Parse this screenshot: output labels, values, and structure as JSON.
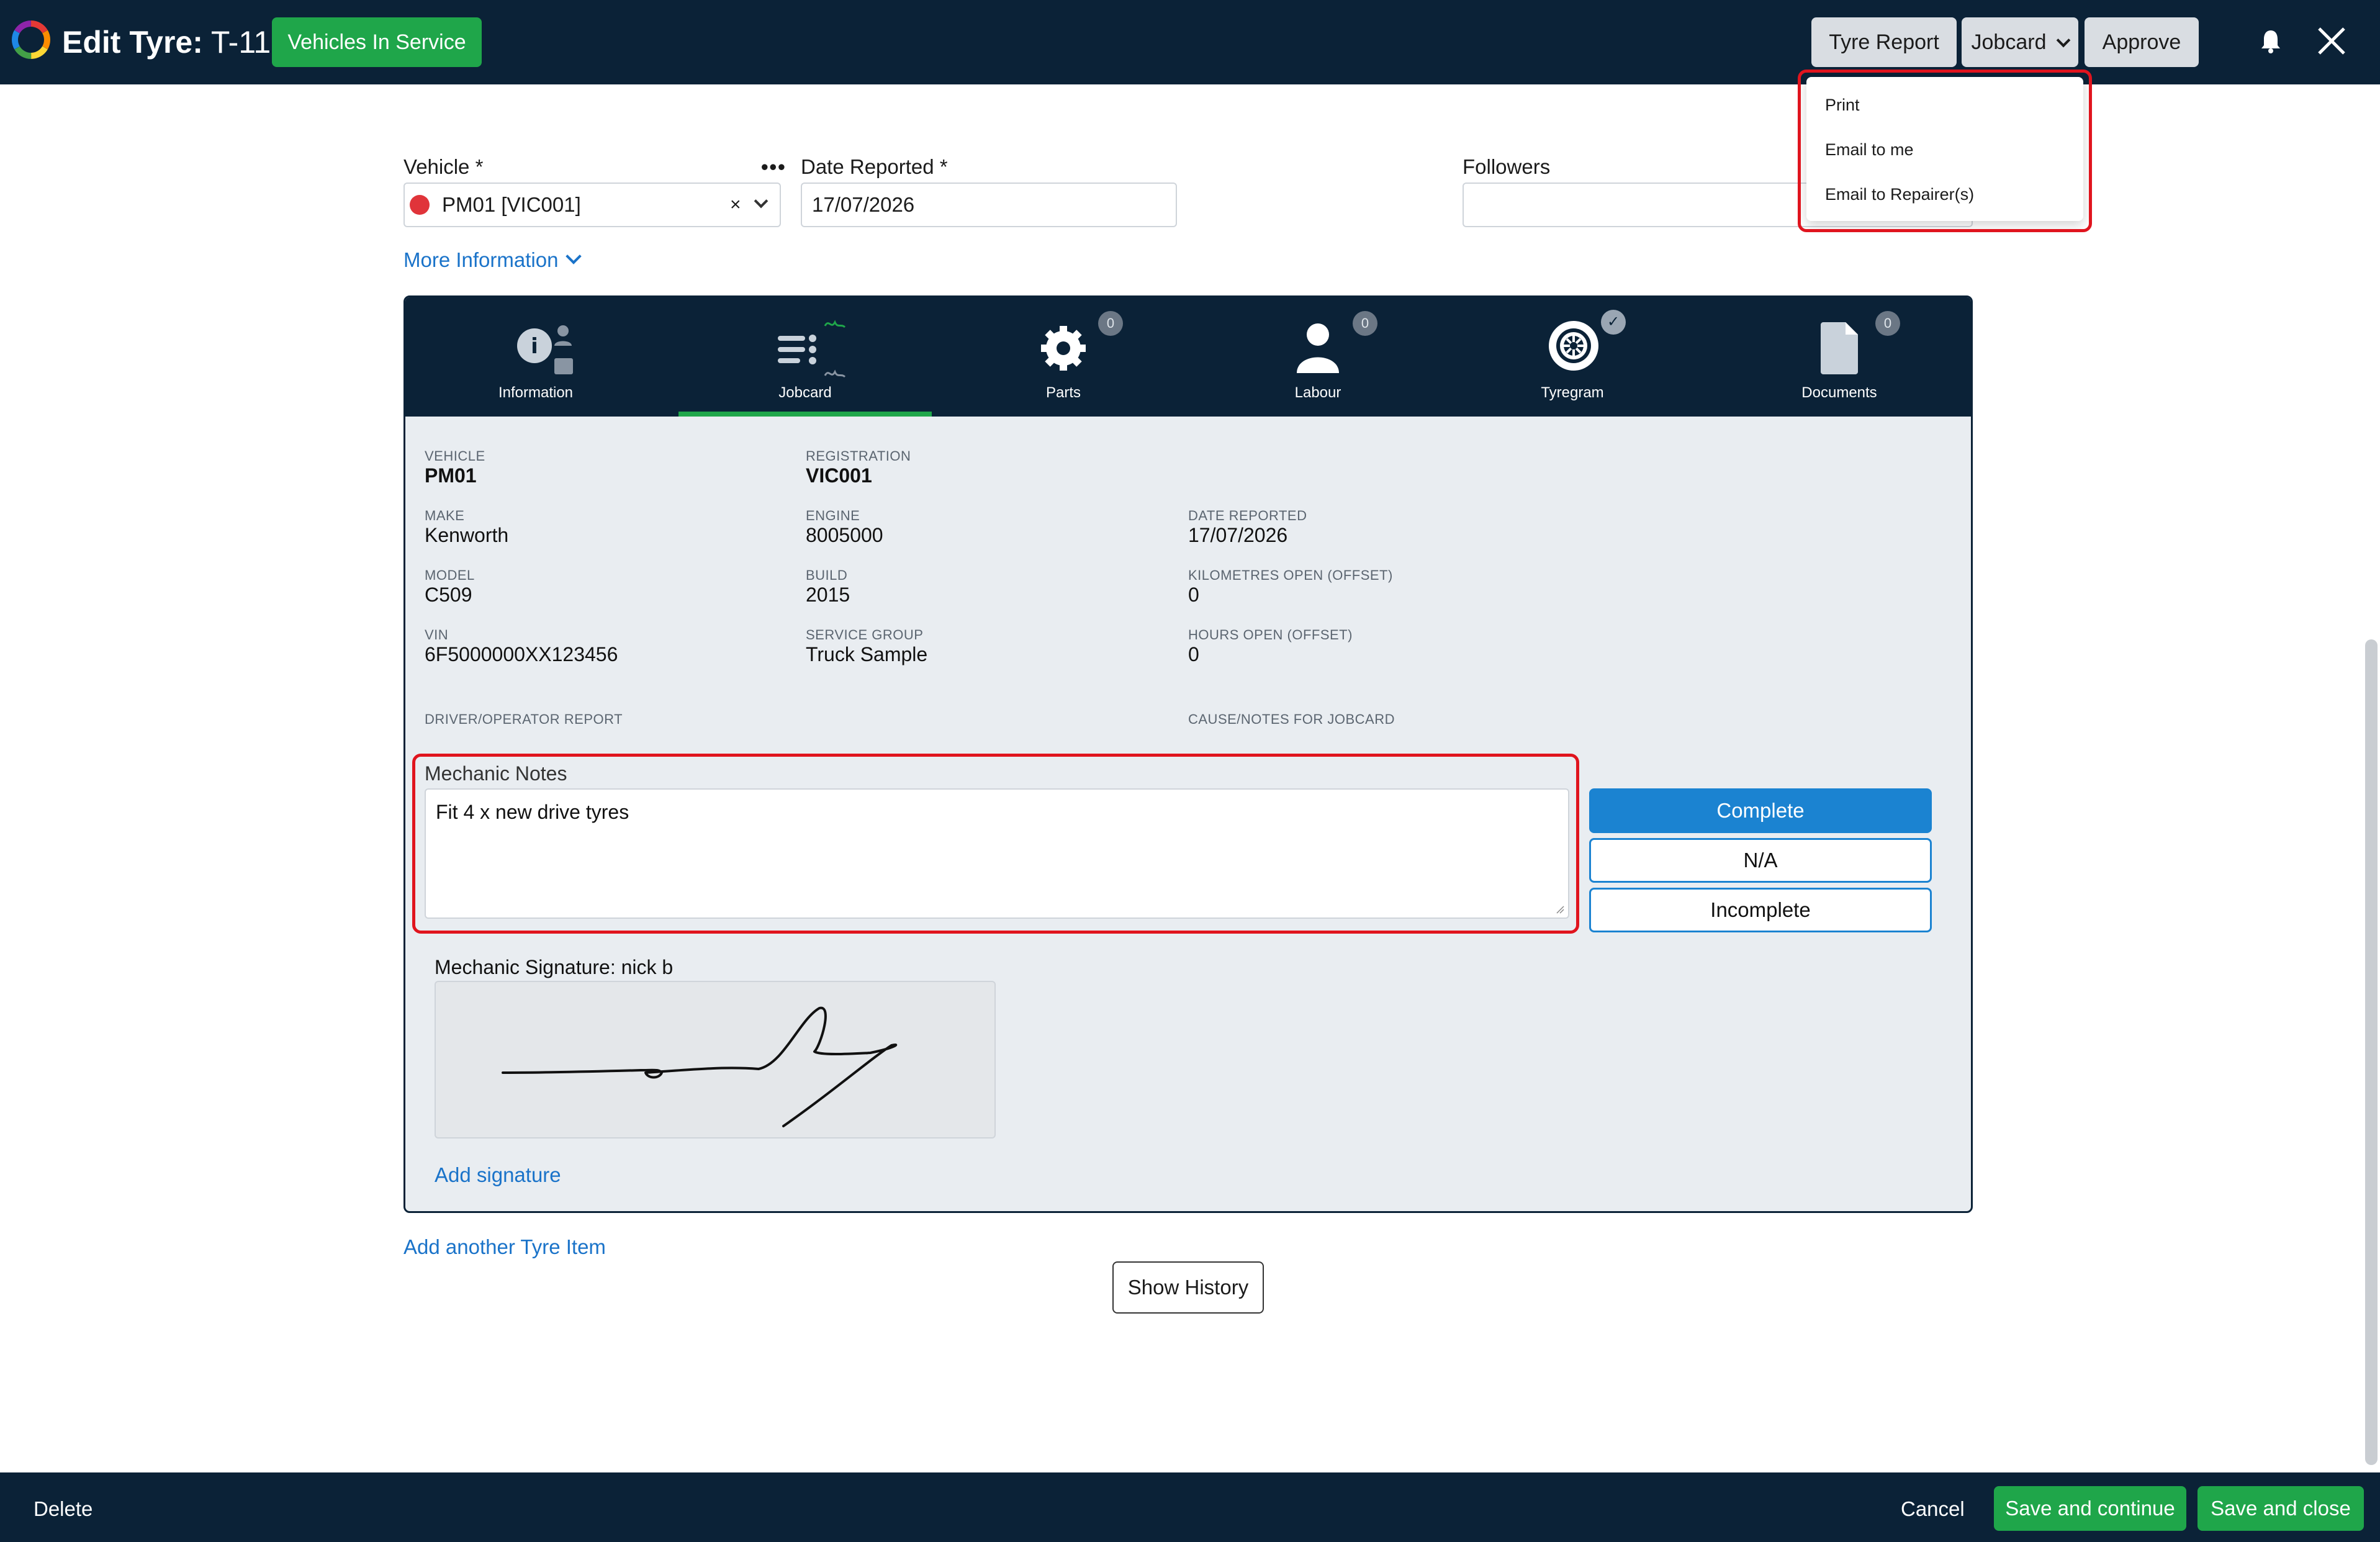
{
  "header": {
    "title_prefix": "Edit Tyre:",
    "title_id": "T-11",
    "status_label": "Vehicles In Service",
    "tyre_report_label": "Tyre Report",
    "jobcard_label": "Jobcard",
    "approve_label": "Approve"
  },
  "jobcard_menu": {
    "items": [
      "Print",
      "Email to me",
      "Email to Repairer(s)"
    ]
  },
  "form": {
    "vehicle_label": "Vehicle *",
    "vehicle_value": "PM01 [VIC001]",
    "vehicle_clear": "×",
    "date_label": "Date Reported *",
    "date_value": "17/07/2026",
    "followers_label": "Followers",
    "more_info_label": "More Information",
    "more_icon": "•••"
  },
  "tabs": [
    {
      "label": "Information",
      "badge": ""
    },
    {
      "label": "Jobcard",
      "badge": ""
    },
    {
      "label": "Parts",
      "badge": "0"
    },
    {
      "label": "Labour",
      "badge": "0"
    },
    {
      "label": "Tyregram",
      "badge": "✓"
    },
    {
      "label": "Documents",
      "badge": "0"
    }
  ],
  "details": {
    "vehicle": {
      "label": "VEHICLE",
      "value": "PM01"
    },
    "registration": {
      "label": "REGISTRATION",
      "value": "VIC001"
    },
    "make": {
      "label": "MAKE",
      "value": "Kenworth"
    },
    "engine": {
      "label": "ENGINE",
      "value": "8005000"
    },
    "date_reported": {
      "label": "DATE REPORTED",
      "value": "17/07/2026"
    },
    "model": {
      "label": "MODEL",
      "value": "C509"
    },
    "build": {
      "label": "BUILD",
      "value": "2015"
    },
    "km_open": {
      "label": "KILOMETRES OPEN (OFFSET)",
      "value": "0"
    },
    "vin": {
      "label": "VIN",
      "value": "6F5000000XX123456"
    },
    "service_group": {
      "label": "SERVICE GROUP",
      "value": "Truck Sample"
    },
    "hours_open": {
      "label": "HOURS OPEN (OFFSET)",
      "value": "0"
    },
    "driver_report_label": "DRIVER/OPERATOR REPORT",
    "cause_notes_label": "CAUSE/NOTES FOR JOBCARD"
  },
  "mechanic": {
    "notes_label": "Mechanic Notes",
    "notes_value": "Fit 4 x new drive tyres",
    "complete_label": "Complete",
    "na_label": "N/A",
    "incomplete_label": "Incomplete",
    "signature_label": "Mechanic Signature: nick b",
    "add_signature_label": "Add signature"
  },
  "footer_links": {
    "add_item_label": "Add another Tyre Item",
    "show_history_label": "Show History"
  },
  "bottom": {
    "delete_label": "Delete",
    "cancel_label": "Cancel",
    "save_continue_label": "Save and continue",
    "save_close_label": "Save and close"
  },
  "colors": {
    "navy": "#0b2237",
    "green": "#1fa64a",
    "blue": "#1b83d1",
    "highlight_red": "#e0141e"
  }
}
